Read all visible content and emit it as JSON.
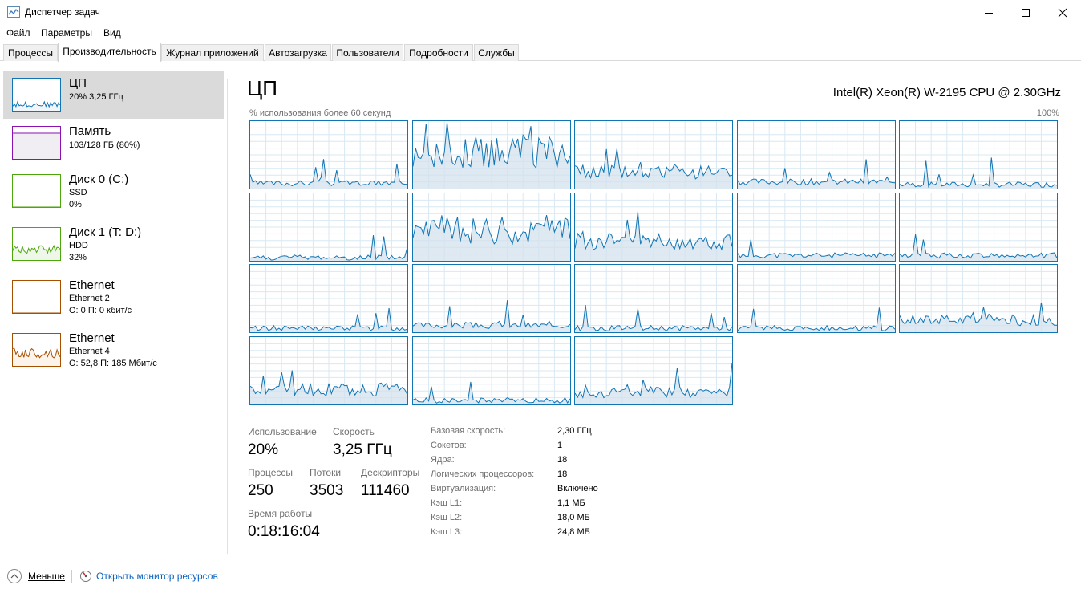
{
  "window": {
    "title": "Диспетчер задач",
    "icons": [
      "task-manager-icon",
      "minimize-icon",
      "maximize-icon",
      "close-icon"
    ]
  },
  "menu": [
    "Файл",
    "Параметры",
    "Вид"
  ],
  "tabs": [
    "Процессы",
    "Производительность",
    "Журнал приложений",
    "Автозагрузка",
    "Пользователи",
    "Подробности",
    "Службы"
  ],
  "active_tab": "Производительность",
  "sidebar": [
    {
      "title": "ЦП",
      "line2": "20% 3,25 ГГц",
      "line3": "",
      "color": "#1175b4",
      "fill": "#f1f6fa",
      "usage": 20
    },
    {
      "title": "Память",
      "line2": "103/128 ГБ (80%)",
      "line3": "",
      "color": "#8b12ae",
      "fill": "#f1eef3",
      "usage": 80
    },
    {
      "title": "Диск 0 (C:)",
      "line2": "SSD",
      "line3": "0%",
      "color": "#4da60c",
      "fill": "#eff7ea",
      "usage": 0
    },
    {
      "title": "Диск 1 (T: D:)",
      "line2": "HDD",
      "line3": "32%",
      "color": "#4da60c",
      "fill": "#eff7ea",
      "usage": 32
    },
    {
      "title": "Ethernet",
      "line2": "Ethernet 2",
      "line3": "О: 0 П: 0 кбит/с",
      "color": "#a74f01",
      "fill": "#fcf3eb",
      "usage": 0
    },
    {
      "title": "Ethernet",
      "line2": "Ethernet 4",
      "line3": "О: 52,8 П: 185 Мбит/с",
      "color": "#a74f01",
      "fill": "#fcf3eb",
      "usage": 40
    }
  ],
  "main": {
    "heading": "ЦП",
    "cpu_model": "Intel(R) Xeon(R) W-2195 CPU @ 2.30GHz",
    "graph_label": "% использования более 60 секунд",
    "graph_max": "100%",
    "graph_color": "#1175b4",
    "graph_fill": "#d3e2ee",
    "graph_grid": "#d9e8f2",
    "logical_processors": 18,
    "core_levels_percent": [
      8,
      55,
      25,
      10,
      6,
      5,
      45,
      30,
      8,
      8,
      6,
      10,
      6,
      6,
      18,
      22,
      6,
      18
    ]
  },
  "stats": {
    "usage_label": "Использование",
    "usage": "20%",
    "speed_label": "Скорость",
    "speed": "3,25 ГГц",
    "processes_label": "Процессы",
    "processes": "250",
    "threads_label": "Потоки",
    "threads": "3503",
    "handles_label": "Дескрипторы",
    "handles": "111460",
    "uptime_label": "Время работы",
    "uptime": "0:18:16:04"
  },
  "specs": [
    {
      "label": "Базовая скорость:",
      "value": "2,30 ГГц"
    },
    {
      "label": "Сокетов:",
      "value": "1"
    },
    {
      "label": "Ядра:",
      "value": "18"
    },
    {
      "label": "Логических процессоров:",
      "value": "18"
    },
    {
      "label": "Виртуализация:",
      "value": "Включено"
    },
    {
      "label": "Кэш L1:",
      "value": "1,1 МБ"
    },
    {
      "label": "Кэш L2:",
      "value": "18,0 МБ"
    },
    {
      "label": "Кэш L3:",
      "value": "24,8 МБ"
    }
  ],
  "footer": {
    "fewer": "Меньше",
    "monitor": "Открыть монитор ресурсов"
  }
}
